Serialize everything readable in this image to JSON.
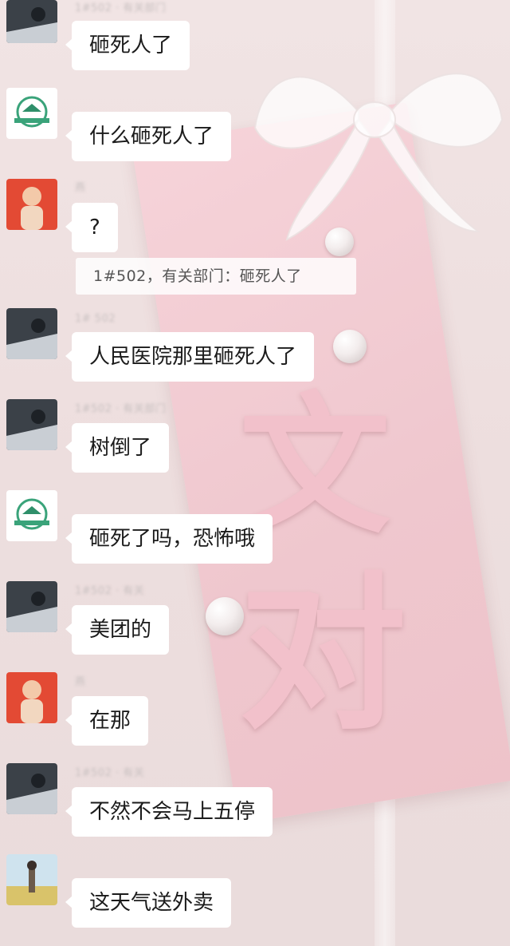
{
  "messages": [
    {
      "id": "m1",
      "avatar": "car-avatar",
      "sender": "1#502 · 有关部门",
      "text": "砸死人了"
    },
    {
      "id": "m2",
      "avatar": "logo-avatar",
      "sender": "",
      "text": "什么砸死人了"
    },
    {
      "id": "m3",
      "avatar": "baby-avatar",
      "sender": "燕",
      "text": "?"
    },
    {
      "id": "m4",
      "avatar": "car-avatar",
      "sender": "1# 502",
      "text": "人民医院那里砸死人了"
    },
    {
      "id": "m5",
      "avatar": "car-avatar",
      "sender": "1#502 · 有关部门",
      "text": "树倒了"
    },
    {
      "id": "m6",
      "avatar": "logo-avatar",
      "sender": "",
      "text": "砸死了吗，恐怖哦"
    },
    {
      "id": "m7",
      "avatar": "car-avatar",
      "sender": "1#502 · 有关",
      "text": "美团的"
    },
    {
      "id": "m8",
      "avatar": "baby-avatar",
      "sender": "燕",
      "text": "在那"
    },
    {
      "id": "m9",
      "avatar": "car-avatar",
      "sender": "1#502 · 有关",
      "text": "不然不会马上五停"
    },
    {
      "id": "m10",
      "avatar": "landscape-avatar",
      "sender": "",
      "text": "这天气送外卖"
    }
  ],
  "quote": {
    "text": "1#502，有关部门：砸死人了"
  },
  "colors": {
    "bubble": "#ffffff",
    "card": "#f2c6cd",
    "text": "#1b1b1b",
    "sender": "#a9a2a2"
  }
}
